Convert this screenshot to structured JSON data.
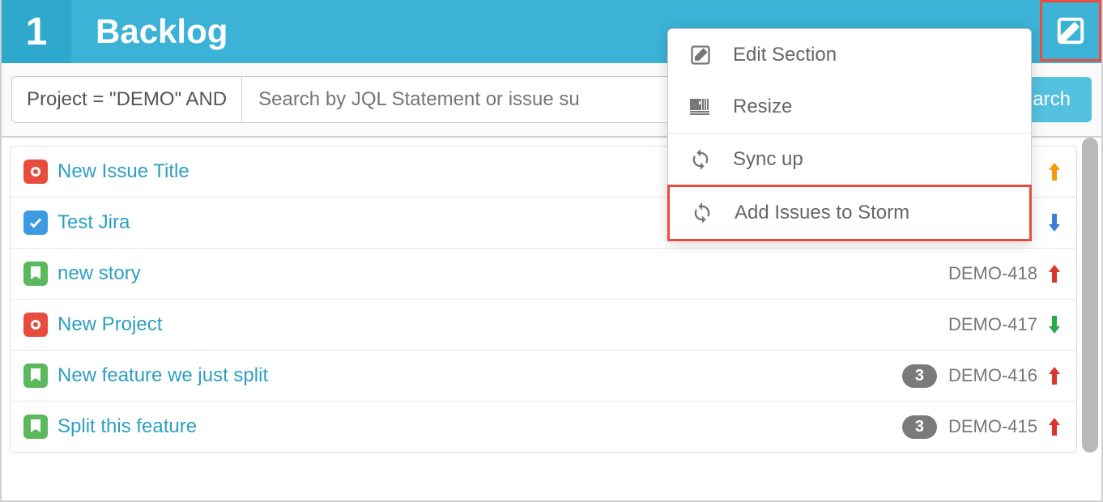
{
  "header": {
    "number": "1",
    "title": "Backlog"
  },
  "search": {
    "prefix": "Project = \"DEMO\" AND",
    "placeholder": "Search by JQL Statement or issue su",
    "button": "arch"
  },
  "dropdown": {
    "items": [
      {
        "label": "Edit Section",
        "icon": "edit"
      },
      {
        "label": "Resize",
        "icon": "resize"
      },
      {
        "label": "Sync up",
        "icon": "sync"
      },
      {
        "label": "Add Issues to Storm",
        "icon": "sync",
        "highlighted": true
      }
    ]
  },
  "issues": [
    {
      "type": "red",
      "title": "New Issue Title",
      "key": "",
      "badge": "",
      "arrow": "up-orange"
    },
    {
      "type": "blue",
      "title": "Test Jira",
      "key": "",
      "badge": "",
      "arrow": "down-blue"
    },
    {
      "type": "green",
      "title": "new story",
      "key": "DEMO-418",
      "badge": "",
      "arrow": "up-red"
    },
    {
      "type": "red",
      "title": "New Project",
      "key": "DEMO-417",
      "badge": "",
      "arrow": "down-green"
    },
    {
      "type": "green",
      "title": "New feature we just split",
      "key": "DEMO-416",
      "badge": "3",
      "arrow": "up-red"
    },
    {
      "type": "green",
      "title": "Split this feature",
      "key": "DEMO-415",
      "badge": "3",
      "arrow": "up-red"
    }
  ]
}
